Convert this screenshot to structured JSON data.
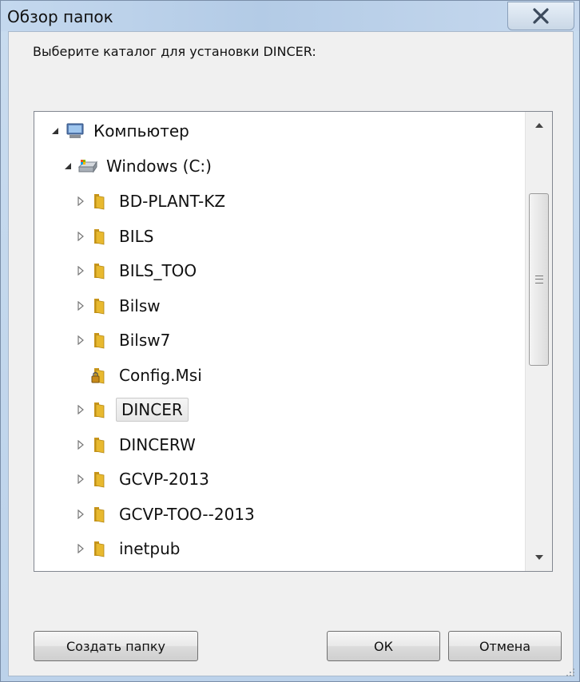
{
  "window": {
    "title": "Обзор папок"
  },
  "prompt": "Выберите каталог для установки DINCER:",
  "tree": {
    "computer": "Компьютер",
    "drive": "Windows (C:)",
    "folders": [
      {
        "label": "BD-PLANT-KZ"
      },
      {
        "label": "BILS"
      },
      {
        "label": "BILS_TOO"
      },
      {
        "label": "Bilsw"
      },
      {
        "label": "Bilsw7"
      },
      {
        "label": "Config.Msi",
        "locked": true
      },
      {
        "label": "DINCER",
        "selected": true
      },
      {
        "label": "DINCERW"
      },
      {
        "label": "GCVP-2013"
      },
      {
        "label": "GCVP-TOO--2013"
      },
      {
        "label": "inetpub"
      }
    ]
  },
  "buttons": {
    "new_folder": "Создать папку",
    "ok": "ОК",
    "cancel": "Отмена"
  },
  "colors": {
    "folder": "#e8b92f",
    "selection": "#e6e6e6"
  }
}
